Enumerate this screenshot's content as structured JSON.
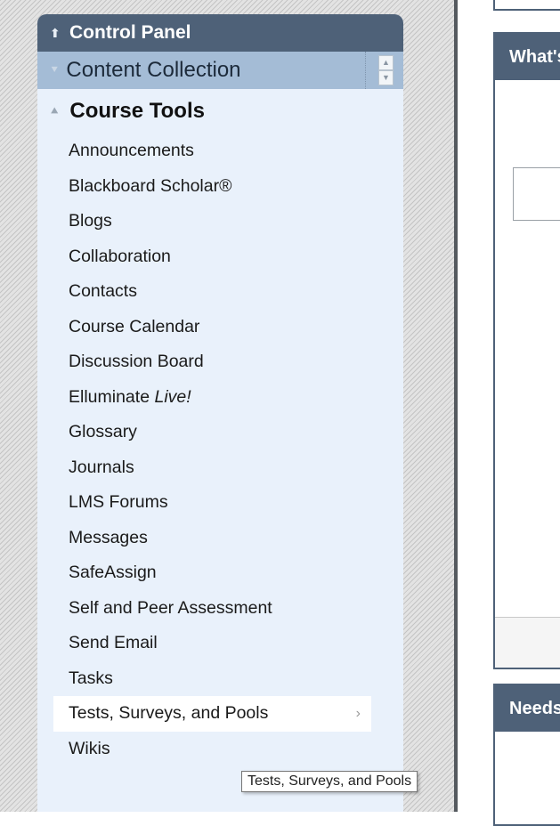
{
  "control_panel": {
    "title": "Control Panel",
    "content_collection": "Content Collection",
    "course_tools": {
      "title": "Course Tools",
      "items": [
        {
          "label": "Announcements"
        },
        {
          "label": "Blackboard Scholar®"
        },
        {
          "label": "Blogs"
        },
        {
          "label": "Collaboration"
        },
        {
          "label": "Contacts"
        },
        {
          "label": "Course Calendar"
        },
        {
          "label": "Discussion Board"
        },
        {
          "label": "Elluminate",
          "label_italic": "Live!"
        },
        {
          "label": "Glossary"
        },
        {
          "label": "Journals"
        },
        {
          "label": "LMS Forums"
        },
        {
          "label": "Messages"
        },
        {
          "label": "SafeAssign"
        },
        {
          "label": "Self and Peer Assessment"
        },
        {
          "label": "Send Email"
        },
        {
          "label": "Tasks"
        },
        {
          "label": "Tests, Surveys, and Pools",
          "active": true
        },
        {
          "label": "Wikis"
        }
      ]
    }
  },
  "tooltip": "Tests, Surveys, and Pools",
  "modules": [
    {
      "title": "What's New"
    },
    {
      "title": "Needs Attention"
    }
  ],
  "colors": {
    "header": "#4e6178",
    "panel_bg": "#e9f1fb",
    "content_collection_bg": "#a4bcd6"
  }
}
